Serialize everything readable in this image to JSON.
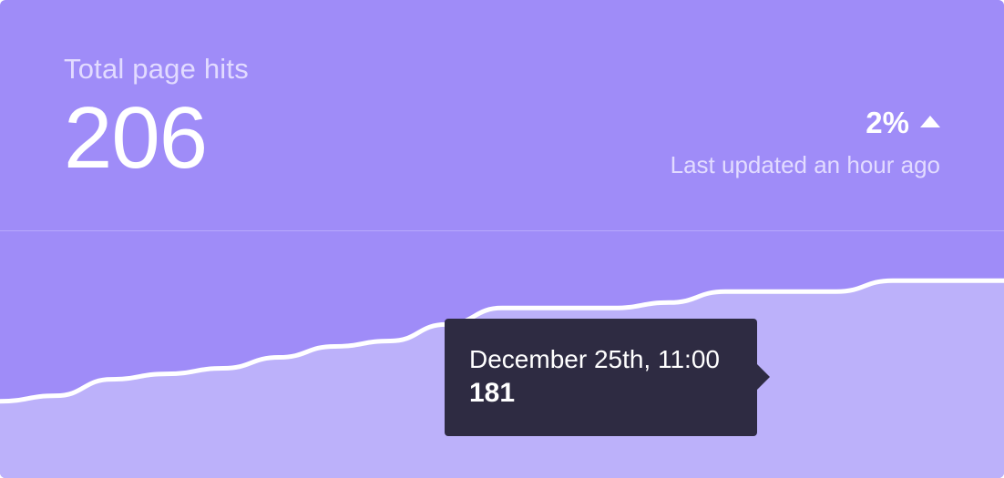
{
  "header": {
    "title": "Total page hits",
    "total": "206",
    "change": "2%",
    "change_direction_icon": "arrow-up-icon",
    "updated": "Last updated an hour ago"
  },
  "tooltip": {
    "date": "December 25th, 11:00",
    "value": "181"
  },
  "colors": {
    "card_background": "#9f8cf8",
    "area_fill": "#bcb1fa",
    "line": "#ffffff",
    "tooltip_background": "#2e2b42"
  },
  "chart_data": {
    "type": "area",
    "series": [
      {
        "values": [
          164,
          165,
          168,
          169,
          170,
          172,
          174,
          175,
          178,
          181,
          181,
          181,
          182,
          184,
          184,
          184,
          186,
          186,
          186
        ]
      }
    ],
    "highlighted_index": 9,
    "highlighted_label": "December 25th, 11:00",
    "highlighted_value": 181,
    "ylim": [
      150,
      195
    ],
    "grid": false
  }
}
